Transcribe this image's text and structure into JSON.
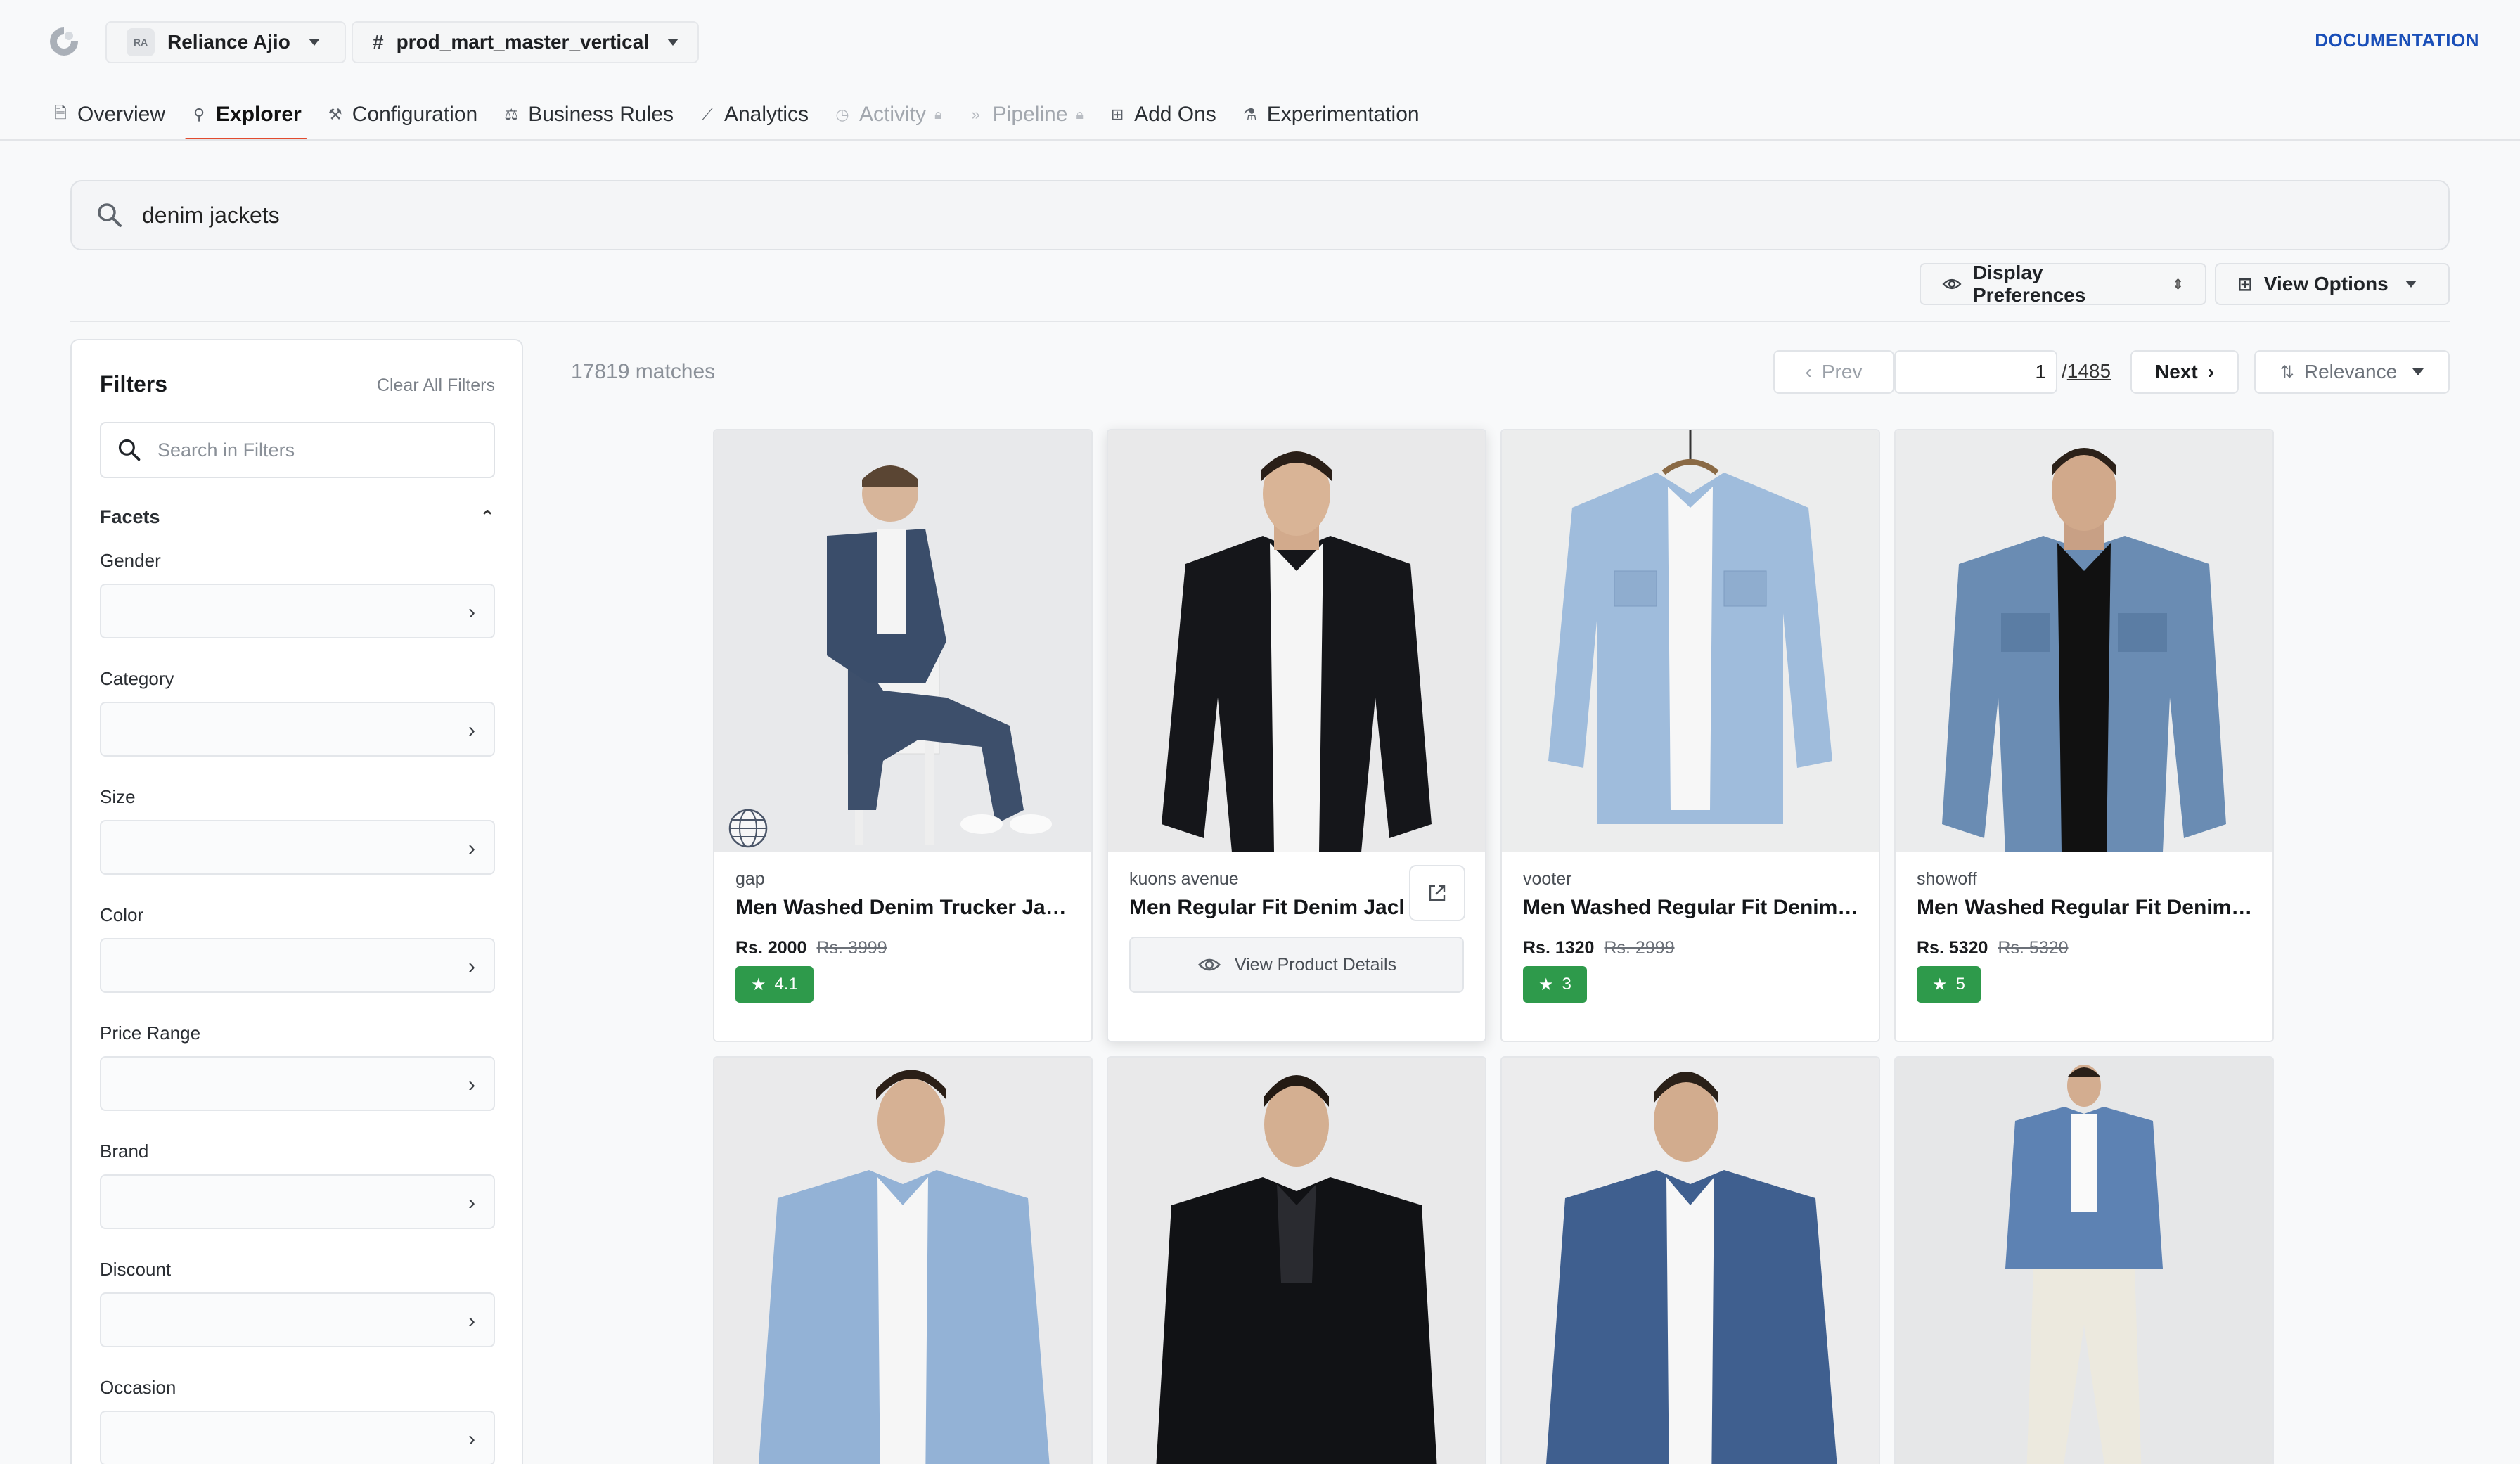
{
  "header": {
    "org_badge": "RA",
    "org_name": "Reliance Ajio",
    "index_hash": "#",
    "index_name": "prod_mart_master_vertical",
    "documentation": "DOCUMENTATION"
  },
  "tabs": [
    {
      "label": "Overview",
      "icon": "document-icon",
      "active": false,
      "disabled": false
    },
    {
      "label": "Explorer",
      "icon": "search-icon",
      "active": true,
      "disabled": false
    },
    {
      "label": "Configuration",
      "icon": "tools-icon",
      "active": false,
      "disabled": false
    },
    {
      "label": "Business Rules",
      "icon": "gavel-icon",
      "active": false,
      "disabled": false
    },
    {
      "label": "Analytics",
      "icon": "trend-icon",
      "active": false,
      "disabled": false
    },
    {
      "label": "Activity",
      "icon": "clock-icon",
      "active": false,
      "disabled": true
    },
    {
      "label": "Pipeline",
      "icon": "double-chevron-icon",
      "active": false,
      "disabled": true
    },
    {
      "label": "Add Ons",
      "icon": "grid-icon",
      "active": false,
      "disabled": false
    },
    {
      "label": "Experimentation",
      "icon": "flask-icon",
      "active": false,
      "disabled": false
    }
  ],
  "search": {
    "query": "denim jackets"
  },
  "toolbar": {
    "display_preferences": "Display Preferences",
    "view_options": "View Options"
  },
  "filters": {
    "title": "Filters",
    "clear_all": "Clear All Filters",
    "search_placeholder": "Search in Filters",
    "facets_heading": "Facets",
    "facets": [
      "Gender",
      "Category",
      "Size",
      "Color",
      "Price Range",
      "Brand",
      "Discount",
      "Occasion"
    ]
  },
  "results": {
    "matches": "17819 matches",
    "prev": "Prev",
    "page": "1",
    "page_sep": "/",
    "total_pages": "1485",
    "next": "Next",
    "sort": "Relevance"
  },
  "products": [
    {
      "brand": "gap",
      "name": "Men Washed Denim Trucker Jacket",
      "price": "Rs. 2000",
      "mrp": "Rs. 3999",
      "rating": "4.1"
    },
    {
      "brand": "kuons avenue",
      "name": "Men Regular Fit Denim Jacket",
      "view_details": "View Product Details"
    },
    {
      "brand": "vooter",
      "name": "Men Washed Regular Fit Denim Jacket",
      "price": "Rs. 1320",
      "mrp": "Rs. 2999",
      "rating": "3"
    },
    {
      "brand": "showoff",
      "name": "Men Washed Regular Fit Denim Jacket",
      "price": "Rs. 5320",
      "mrp": "Rs. 5320",
      "rating": "5"
    }
  ],
  "colors": {
    "accent": "#e24b2e",
    "doc_link": "#1a4fb8",
    "rating_green": "#2e9a4b"
  }
}
